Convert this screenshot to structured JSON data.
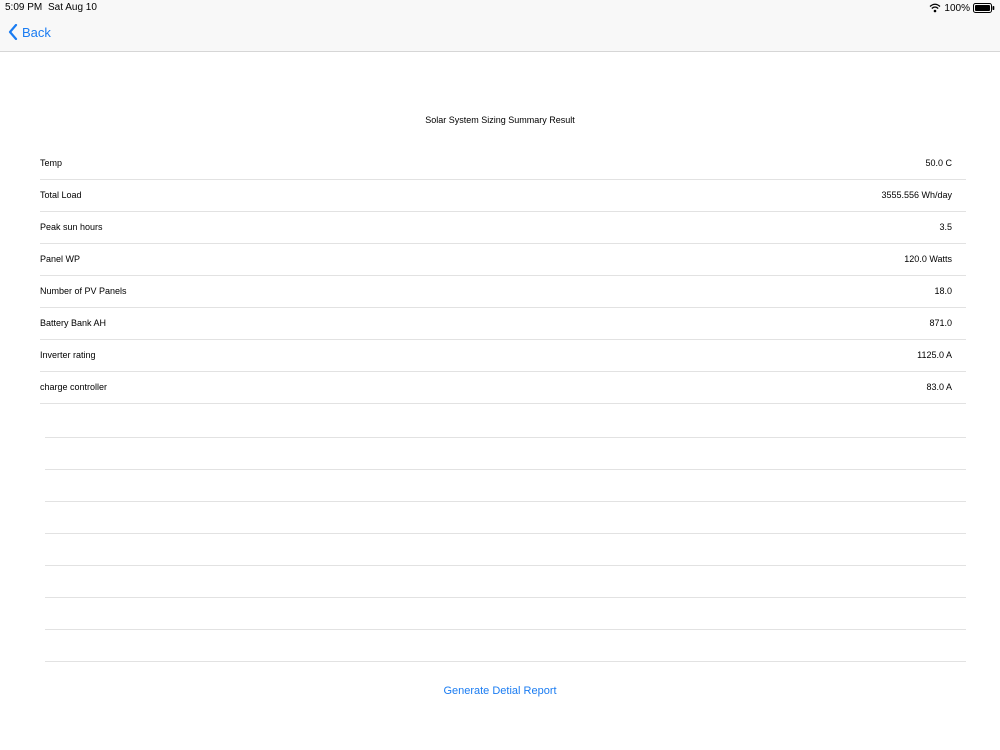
{
  "status_bar": {
    "time": "5:09 PM",
    "date": "Sat Aug 10",
    "battery": "100%"
  },
  "nav": {
    "back_label": "Back"
  },
  "summary": {
    "title": "Solar System  Sizing Summary Result",
    "rows": [
      {
        "label": "Temp",
        "value": "50.0 C"
      },
      {
        "label": "Total Load",
        "value": "3555.556 Wh/day"
      },
      {
        "label": "Peak sun hours",
        "value": "3.5"
      },
      {
        "label": "Panel WP",
        "value": "120.0 Watts"
      },
      {
        "label": "Number of PV Panels",
        "value": "18.0"
      },
      {
        "label": "Battery Bank AH",
        "value": "871.0"
      },
      {
        "label": "Inverter rating",
        "value": "1125.0 A"
      },
      {
        "label": "charge controller",
        "value": "83.0 A"
      }
    ]
  },
  "actions": {
    "report_label": "Generate Detial Report"
  },
  "colors": {
    "accent": "#1a7cf2",
    "nav_bg": "#f8f8f8",
    "separator": "#e2e2e2"
  }
}
